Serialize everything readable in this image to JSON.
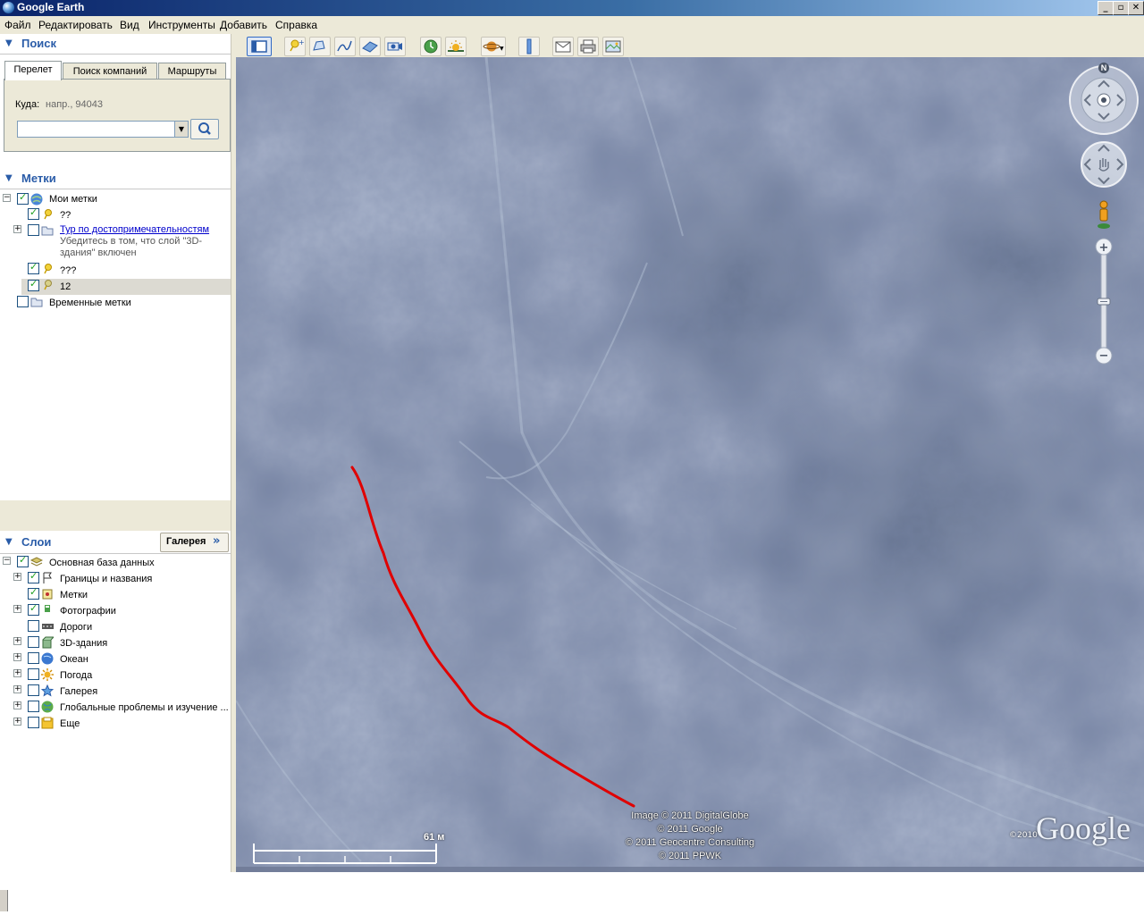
{
  "window": {
    "title": "Google Earth",
    "btn_minimize": "_",
    "btn_restore": "▫",
    "btn_close": "✕"
  },
  "menu": [
    "Файл",
    "Редактировать",
    "Вид",
    "Инструменты",
    "Добавить",
    "Справка"
  ],
  "search": {
    "header": "Поиск",
    "tabs": [
      "Перелет",
      "Поиск компаний",
      "Маршруты"
    ],
    "to_label": "Куда:",
    "to_hint": "напр., 94043",
    "input_value": ""
  },
  "places": {
    "header": "Метки",
    "items": [
      {
        "label": "Мои метки",
        "checked": true
      },
      {
        "label": "??",
        "checked": true
      },
      {
        "label": "Тур по достопримечательностям",
        "checked": false
      },
      {
        "label": "Убедитесь в том, что слой \"3D-",
        "checked": false
      },
      {
        "label": "здания\" включен",
        "checked": false
      },
      {
        "label": "???",
        "checked": true
      },
      {
        "label": "12",
        "checked": true
      },
      {
        "label": "Временные метки",
        "checked": false
      }
    ]
  },
  "layers": {
    "header": "Слои",
    "gallery_button": "Галерея",
    "items": [
      {
        "label": "Основная база данных",
        "checked": true
      },
      {
        "label": "Границы и названия",
        "checked": true
      },
      {
        "label": "Метки",
        "checked": true
      },
      {
        "label": "Фотографии",
        "checked": true
      },
      {
        "label": "Дороги",
        "checked": false
      },
      {
        "label": "3D-здания",
        "checked": false
      },
      {
        "label": "Океан",
        "checked": false
      },
      {
        "label": "Погода",
        "checked": false
      },
      {
        "label": "Галерея",
        "checked": false
      },
      {
        "label": "Глобальные проблемы и изучение ...",
        "checked": false
      },
      {
        "label": "Еще",
        "checked": false
      }
    ]
  },
  "map": {
    "credits": [
      "Image © 2011 DigitalGlobe",
      "© 2011 Google",
      "© 2011 Geocentre Consulting",
      "© 2011 PPWK"
    ],
    "scale_label": "61 м",
    "logo": "Google",
    "logo_year": "©2010",
    "compass_north": "N"
  },
  "colors": {
    "path": "#e00000",
    "accent": "#2a5ca8",
    "map_base": "#7d8aa8"
  }
}
